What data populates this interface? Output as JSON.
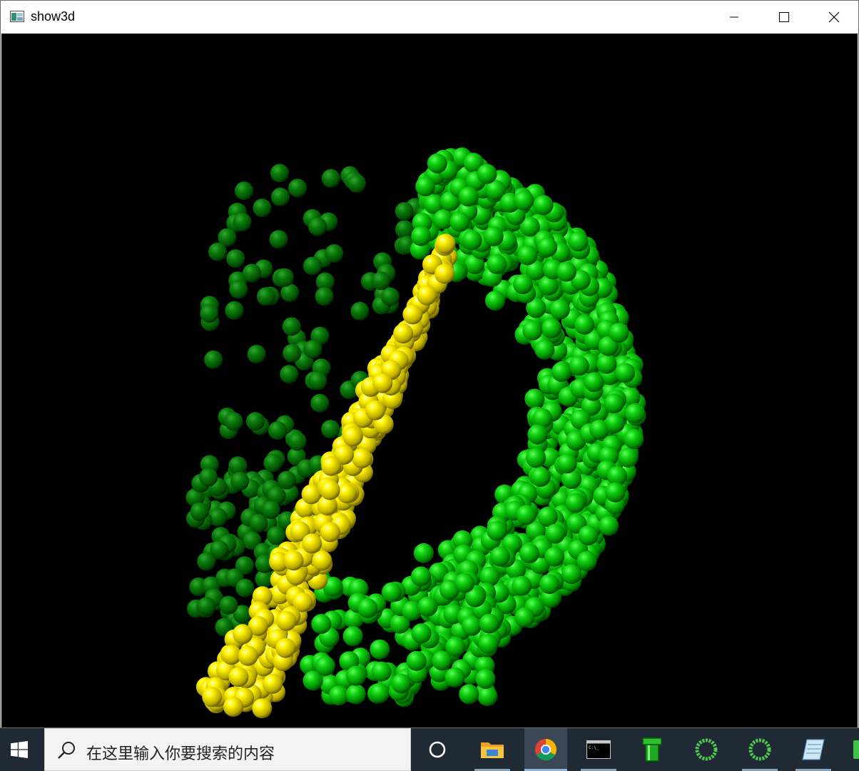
{
  "window": {
    "title": "show3d"
  },
  "scene": {
    "background": "#000000",
    "green_color": "#00c800",
    "yellow_color": "#f0e000"
  },
  "taskbar": {
    "search_placeholder": "在这里输入你要搜索的内容",
    "items": [
      {
        "name": "cortana",
        "icon": "circle-icon"
      },
      {
        "name": "file-explorer",
        "icon": "folder-icon"
      },
      {
        "name": "chrome",
        "icon": "chrome-icon",
        "active": true
      },
      {
        "name": "command-prompt",
        "icon": "terminal-icon"
      },
      {
        "name": "pipe-app",
        "icon": "pipe-icon"
      },
      {
        "name": "spinner-app-1",
        "icon": "ring-icon"
      },
      {
        "name": "spinner-app-2",
        "icon": "ring-icon"
      },
      {
        "name": "notepad-app",
        "icon": "notepad-icon"
      },
      {
        "name": "green-app",
        "icon": "green-app-icon"
      }
    ]
  }
}
